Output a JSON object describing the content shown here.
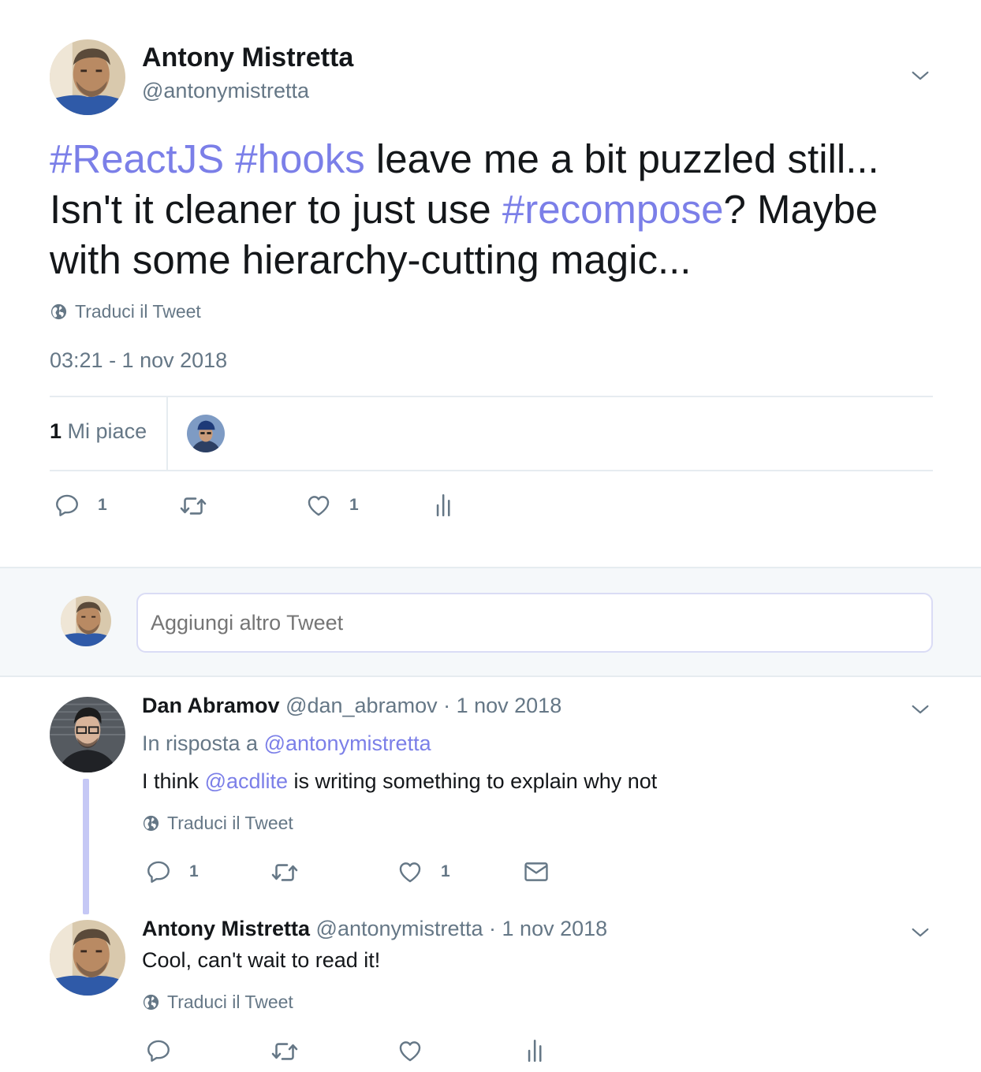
{
  "colors": {
    "link": "#7b7fe8",
    "muted": "#657786",
    "thread_line": "#c5c8f5",
    "compose_bg": "#f5f8fa"
  },
  "main_tweet": {
    "author_name": "Antony Mistretta",
    "author_handle": "@antonymistretta",
    "text_parts": [
      {
        "text": "#ReactJS",
        "link": true
      },
      {
        "text": " ",
        "link": false
      },
      {
        "text": "#hooks",
        "link": true
      },
      {
        "text": " leave me a bit puzzled still... Isn't it cleaner to just use ",
        "link": false
      },
      {
        "text": "#recompose",
        "link": true
      },
      {
        "text": "? Maybe with some hierarchy-cutting magic...",
        "link": false
      }
    ],
    "translate_label": "Traduci il Tweet",
    "timestamp": "03:21 - 1 nov 2018",
    "likes_count": "1",
    "likes_label": "Mi piace",
    "actions": {
      "reply_count": "1",
      "retweet_count": "",
      "like_count": "1"
    }
  },
  "compose": {
    "placeholder": "Aggiungi altro Tweet"
  },
  "replies": [
    {
      "author_name": "Dan Abramov",
      "author_handle": "@dan_abramov",
      "date": "· 1 nov 2018",
      "in_reply_prefix": "In risposta a",
      "in_reply_handle": "@antonymistretta",
      "text_before": "I think",
      "mention": "@acdlite",
      "text_after": "is writing something to explain why not",
      "translate_label": "Traduci il Tweet",
      "reply_count": "1",
      "like_count": "1"
    },
    {
      "author_name": "Antony Mistretta",
      "author_handle": "@antonymistretta",
      "date": "· 1 nov 2018",
      "text": "Cool, can't wait to read it!",
      "translate_label": "Traduci il Tweet"
    }
  ],
  "icons": [
    "chevron-down-icon",
    "globe-icon",
    "reply-icon",
    "retweet-icon",
    "heart-icon",
    "analytics-icon",
    "mail-icon"
  ]
}
